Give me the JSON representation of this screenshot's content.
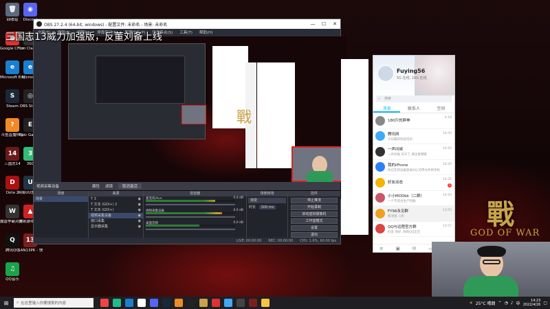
{
  "desktop": {
    "icons": [
      {
        "label": "回收站",
        "glyph": "🗑",
        "color": "#5a6b80"
      },
      {
        "label": "Google Chrome",
        "glyph": "●",
        "color": "#d33"
      },
      {
        "label": "Microsoft Edge",
        "glyph": "e",
        "color": "#1a7fd1"
      },
      {
        "label": "Steam",
        "glyph": "S",
        "color": "#1b2838"
      },
      {
        "label": "斗鱼直播伴侣",
        "glyph": "?",
        "color": "#f08a24"
      },
      {
        "label": "三国志14",
        "glyph": "14",
        "color": "#6a1a1a"
      },
      {
        "label": "Dota 2",
        "glyph": "D",
        "color": "#a11"
      },
      {
        "label": "魔兽争霸对战平台",
        "glyph": "W",
        "color": "#333"
      },
      {
        "label": "腾讯QQ",
        "glyph": "Q",
        "color": "#111"
      },
      {
        "label": "QQ音乐",
        "glyph": "♫",
        "color": "#1aa34a"
      }
    ],
    "icons_col2": [
      {
        "label": "Discord",
        "glyph": "◉",
        "color": "#5865f2"
      },
      {
        "label": "Tom Clancy's",
        "glyph": "T",
        "color": "#333"
      },
      {
        "label": "Microsoft",
        "glyph": "e",
        "color": "#1a7fd1"
      },
      {
        "label": "OBS Studio",
        "glyph": "◎",
        "color": "#222"
      },
      {
        "label": "Epic Games",
        "glyph": "E",
        "color": "#222"
      },
      {
        "label": "360",
        "glyph": "3",
        "color": "#3b7"
      },
      {
        "label": "网易UU加速器",
        "glyph": "U",
        "color": "#234"
      },
      {
        "label": "腾讯游戏助手",
        "glyph": "▲",
        "color": "#c22"
      },
      {
        "label": "SAN13PK - 快捷方式",
        "glyph": "13",
        "color": "#7a1e1e"
      }
    ],
    "wallpaper_glyph": "戰",
    "wallpaper_sub": "GOD OF WAR"
  },
  "overlay_title": "三国志13威力加强版，反董刘备上线",
  "obs": {
    "title": "OBS 27.2.4 (64-bit, windows) - 配置文件: 未命名 - 场景: 未命名",
    "menu": [
      "文件(F)",
      "编辑(E)",
      "视图(V)",
      "停靠窗口(D)",
      "配置文件(P)",
      "场景集合(S)",
      "工具(T)",
      "帮助(H)"
    ],
    "source_name": "视频采集设备",
    "scenebar": {
      "properties": "属性",
      "filters": "滤镜",
      "deactivate": "取消激活"
    },
    "docks": {
      "scenes": "场景",
      "scene_item": "场景",
      "sources": "来源",
      "source_items": [
        "T 3",
        "T 文本 (GDI+) 2",
        "T 文本 (GDI+)",
        "视频采集设备",
        "窗口采集",
        "显示器采集"
      ],
      "mixer": "混音器",
      "mixer_items": [
        {
          "name": "麦克风/Aux",
          "level": 0.78,
          "db": "0.0 dB"
        },
        {
          "name": "视频采集设备",
          "level": 0.85,
          "db": "0.0 dB"
        },
        {
          "name": "桌面音频",
          "level": 0.6,
          "db": "0.0 dB"
        }
      ],
      "transitions": "场景转场",
      "transition_type": "渐变",
      "duration_label": "时长",
      "duration_value": "300 ms",
      "controls": "控件",
      "control_buttons": [
        "停止推流",
        "开始录制",
        "启动虚拟摄像机",
        "工作室模式",
        "设置",
        "退出"
      ]
    },
    "status": {
      "live": "LIVE: 00:00:00",
      "rec": "REC: 00:00:00",
      "cpu": "CPU: 1.6%, 60.00 fps"
    }
  },
  "qq": {
    "name": "Fuying56",
    "signature": "5G 在线, 10G 在线",
    "search_placeholder": "搜索",
    "tabs": [
      "消息",
      "联系人",
      "空间"
    ],
    "messages": [
      {
        "title": "180斤的胖神",
        "preview": "",
        "time": "4-18",
        "color": "#888",
        "badge": ""
      },
      {
        "title": "腾讯网",
        "preview": "今日最新科技资讯",
        "time": "14:20",
        "color": "#3fa9f5",
        "badge": ""
      },
      {
        "title": "一声问候",
        "preview": "一声问候 天冷了,请注意保暖",
        "time": "14:20",
        "color": "#333",
        "badge": ""
      },
      {
        "title": "我的iPhone",
        "preview": "你已在新设备登录QQ,可传文件到手机",
        "time": "14:20",
        "color": "#2d7ff9",
        "badge": ""
      },
      {
        "title": "好友动态",
        "preview": "",
        "time": "14:20",
        "color": "#f4b400",
        "badge": "1"
      },
      {
        "title": "小小MODbk（二群）",
        "preview": "一个不适合生产的群",
        "time": "14:20",
        "color": "#c56",
        "badge": ""
      },
      {
        "title": "FYS6永见群",
        "preview": "新消息, 1条",
        "time": "13:55",
        "color": "#f0a020",
        "badge": ""
      },
      {
        "title": "QQ与远程官方群",
        "preview": "好友 你好 ,你的QQ正在",
        "time": "13:57",
        "color": "#d44",
        "badge": ""
      }
    ]
  },
  "taskbar": {
    "search_placeholder": "在这里输入你要搜索的内容",
    "weather": "25°C 晴朗",
    "time": "14:23",
    "date": "2022/4/26"
  }
}
